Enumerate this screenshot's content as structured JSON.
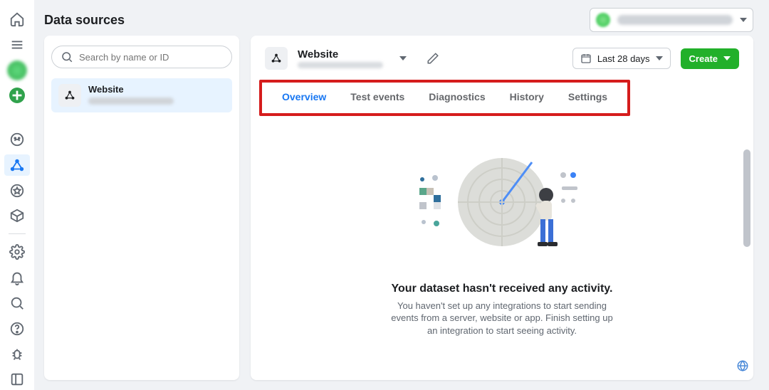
{
  "page": {
    "title": "Data sources"
  },
  "account": {
    "name_redacted": true
  },
  "sidebar": {
    "search_placeholder": "Search by name or ID",
    "items": [
      {
        "label": "Website",
        "id_redacted": true
      }
    ]
  },
  "header": {
    "dataset_name": "Website",
    "dataset_sub_redacted": true
  },
  "date_picker": {
    "label": "Last 28 days"
  },
  "create_button": {
    "label": "Create"
  },
  "tabs": [
    {
      "key": "overview",
      "label": "Overview",
      "active": true
    },
    {
      "key": "test_events",
      "label": "Test events",
      "active": false
    },
    {
      "key": "diagnostics",
      "label": "Diagnostics",
      "active": false
    },
    {
      "key": "history",
      "label": "History",
      "active": false
    },
    {
      "key": "settings",
      "label": "Settings",
      "active": false
    }
  ],
  "empty_state": {
    "title": "Your dataset hasn't received any activity.",
    "desc": "You haven't set up any integrations to start sending events from a server, website or app. Finish setting up an integration to start seeing activity."
  },
  "colors": {
    "accent": "#1877f2",
    "create": "#22b02a",
    "highlight_box": "#d51c1c"
  }
}
